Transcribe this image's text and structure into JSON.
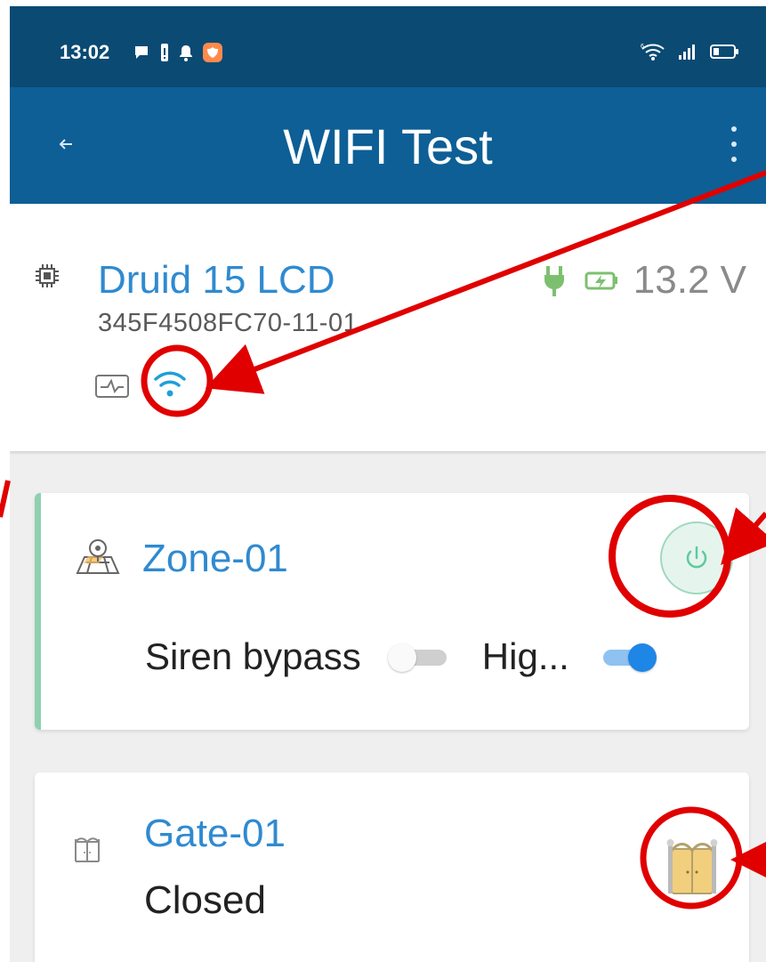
{
  "status_bar": {
    "time": "13:02",
    "left_icons": [
      "chat-icon",
      "battery-alert-icon",
      "bell-icon",
      "shield-app-icon"
    ],
    "right_icons": [
      "wifi-6-icon",
      "signal-icon",
      "battery-icon"
    ]
  },
  "app_bar": {
    "title": "WIFI Test",
    "back_icon": "back-arrow-icon",
    "menu_icon": "more-vert-icon"
  },
  "device": {
    "name": "Druid 15 LCD",
    "id": "345F4508FC70-11-01",
    "voltage": "13.2 V",
    "icons": [
      "chip-icon",
      "plug-icon",
      "battery-charging-icon",
      "monitor-icon",
      "wifi-icon"
    ],
    "colors": {
      "name": "#2f8ad0",
      "wifi": "#1ea0d8",
      "power": "#7cc06f"
    }
  },
  "zone": {
    "name": "Zone-01",
    "options": [
      {
        "label": "Siren bypass",
        "enabled": false
      },
      {
        "label": "Hig...",
        "enabled": true
      }
    ],
    "accent": "#8fd0b0"
  },
  "gate": {
    "name": "Gate-01",
    "status": "Closed",
    "action_icon": "gate-icon",
    "accent": "#f2cf7d"
  },
  "annotations": {
    "color": "#e00000",
    "marked": [
      "wifi-icon",
      "power-button",
      "gate-action-icon"
    ]
  }
}
